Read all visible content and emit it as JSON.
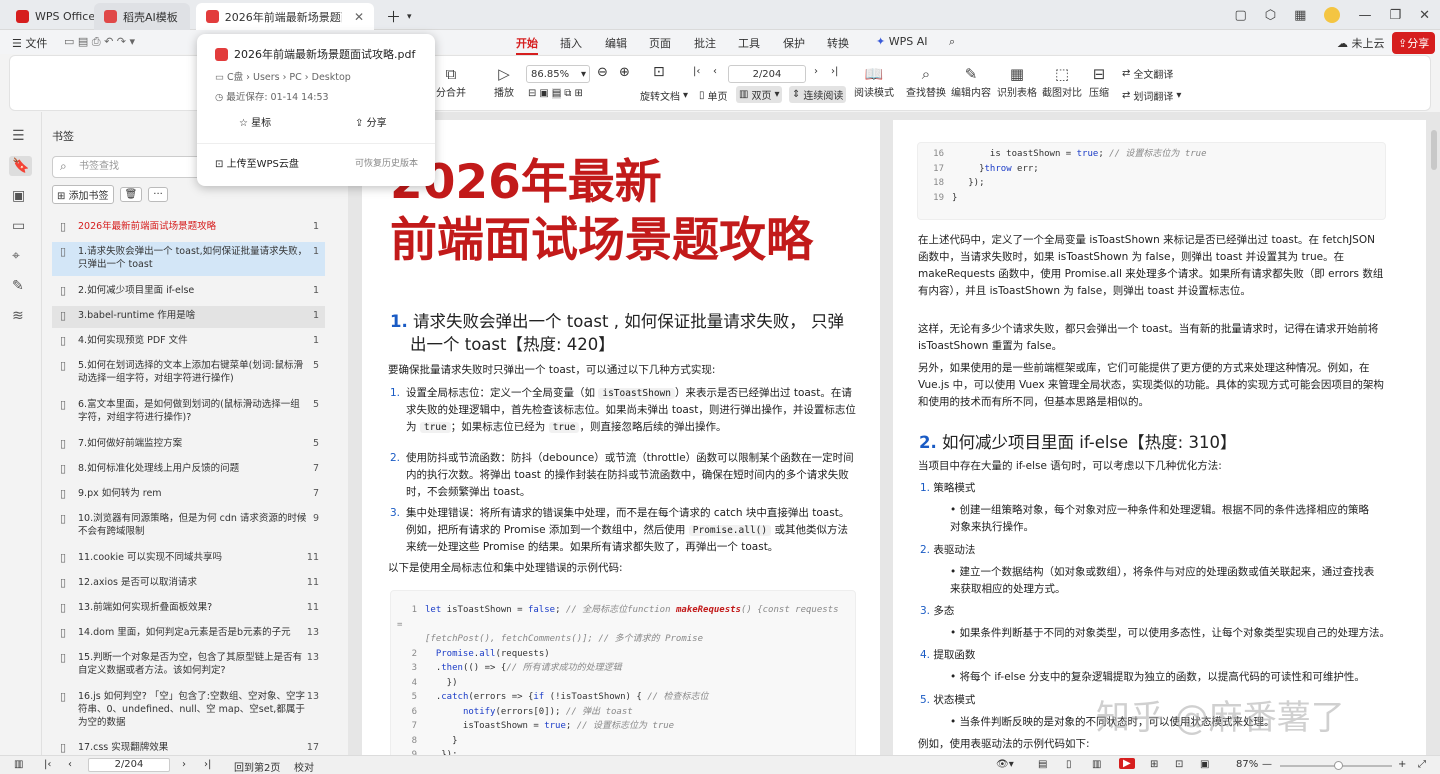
{
  "tabs": [
    {
      "label": "WPS Office"
    },
    {
      "label": "稻壳AI模板"
    },
    {
      "label": "2026年前端最新场景题面试攻"
    }
  ],
  "menu": {
    "file": "文件",
    "items": [
      "开始",
      "插入",
      "编辑",
      "页面",
      "批注",
      "工具",
      "保护",
      "转换"
    ],
    "ai": "WPS AI",
    "cloud": "未上云",
    "share": "分享"
  },
  "popup": {
    "filename": "2026年前端最新场景题面试攻略.pdf",
    "path": "C盘 › Users › PC › Desktop",
    "saved": "最近保存: 01-14 14:53",
    "star": "星标",
    "share": "分享",
    "upload": "上传至WPS云盘",
    "history": "可恢复历史版本"
  },
  "toolbar": {
    "split": "分合并",
    "play": "播放",
    "zoom": "86.85%",
    "page": "2/204",
    "rotate": "旋转文档",
    "single": "单页",
    "double": "双页",
    "continuous": "连续阅读",
    "reading": "阅读模式",
    "find": "查找替换",
    "edit": "编辑内容",
    "table": "识别表格",
    "screenshot": "截图对比",
    "compress": "压缩",
    "translate_all": "全文翻译",
    "translate_sel": "划词翻译"
  },
  "bookmarks": {
    "title": "书签",
    "search_placeholder": "书签查找",
    "add": "添加书签",
    "items": [
      {
        "text": "2026年最新前端面试场景题攻略",
        "page": "1"
      },
      {
        "text": "1.请求失败会弹出一个 toast,如何保证批量请求失败，只弹出一个 toast",
        "page": "1"
      },
      {
        "text": "2.如何减少项目里面 if-else",
        "page": "1"
      },
      {
        "text": "3.babel-runtime 作用是啥",
        "page": "1"
      },
      {
        "text": "4.如何实现预览 PDF 文件",
        "page": "1"
      },
      {
        "text": "5.如何在划词选择的文本上添加右键菜单(划词:鼠标滑动选择一组字符，对组字符进行操作)",
        "page": "5"
      },
      {
        "text": "6.富文本里面，是如何做到划词的(鼠标滑动选择一组字符，对组字符进行操作)?",
        "page": "5"
      },
      {
        "text": "7.如何做好前端监控方案",
        "page": "5"
      },
      {
        "text": "8.如何标准化处理线上用户反馈的问题",
        "page": "7"
      },
      {
        "text": "9.px 如何转为 rem",
        "page": "7"
      },
      {
        "text": "10.浏览器有同源策略，但是为何 cdn 请求资源的时候不会有跨域限制",
        "page": "9"
      },
      {
        "text": "11.cookie 可以实现不同域共享吗",
        "page": "11"
      },
      {
        "text": "12.axios 是否可以取消请求",
        "page": "11"
      },
      {
        "text": " 13.前端如何实现折叠面板效果?",
        "page": "11"
      },
      {
        "text": "14.dom 里面，如何判定a元素是否是b元素的子元",
        "page": "13"
      },
      {
        "text": "15.判断一个对象是否为空，包含了其原型链上是否有自定义数据或者方法。该如何判定?",
        "page": "13"
      },
      {
        "text": "16.js 如何判空? 「空」包含了:空数组、空对象、空字符串、0、undefined、null、空 map、空set,都属于为空的数据",
        "page": "13"
      },
      {
        "text": "17.css 实现翻牌效果",
        "page": "17"
      }
    ]
  },
  "page1": {
    "title_line1": "2026年最新",
    "title_line2": "前端面试场景题攻略",
    "h1_num": "1.",
    "h1_text_a": "请求失败会弹出一个 toast , 如何保证批量请求失败， 只弹",
    "h1_text_b": "出一个 toast【热度: 420】",
    "intro": "要确保批量请求失败时只弹出一个 toast，可以通过以下几种方式实现:",
    "item1_a": "设置全局标志位：定义一个全局变量（如",
    "item1_code": "isToastShown",
    "item1_b": "）来表示是否已经弹出过 toast。在请求失败的处理逻辑中，首先检查该标志位。如果尚未弹出 toast，则进行弹出操作，并设置标志位为",
    "item1_code2": "true",
    "item1_c": "；如果标志位已经为",
    "item1_code3": "true",
    "item1_d": "，则直接忽略后续的弹出操作。",
    "item2": "使用防抖或节流函数：防抖（debounce）或节流（throttle）函数可以限制某个函数在一定时间内的执行次数。将弹出 toast 的操作封装在防抖或节流函数中，确保在短时间内的多个请求失败时，不会频繁弹出 toast。",
    "item3_a": "集中处理错误：将所有请求的错误集中处理，而不是在每个请求的 catch 块中直接弹出 toast。例如，把所有请求的 Promise 添加到一个数组中，然后使用",
    "item3_code": "Promise.all()",
    "item3_b": "或其他类似方法来统一处理这些 Promise 的结果。如果所有请求都失败了，再弹出一个 toast。",
    "code_intro": "以下是使用全局标志位和集中处理错误的示例代码:"
  },
  "page2": {
    "para1": "在上述代码中，定义了一个全局变量 isToastShown 来标记是否已经弹出过 toast。在 fetchJSON 函数中，当请求失败时，如果 isToastShown 为 false，则弹出 toast 并设置其为 true。在 makeRequests 函数中，使用 Promise.all 来处理多个请求。如果所有请求都失败（即 errors 数组有内容），并且 isToastShown 为 false，则弹出 toast 并设置标志位。",
    "para2": "这样，无论有多少个请求失败，都只会弹出一个 toast。当有新的批量请求时，记得在请求开始前将 isToastShown 重置为 false。",
    "para3": "另外，如果使用的是一些前端框架或库，它们可能提供了更方便的方式来处理这种情况。例如，在 Vue.js 中，可以使用 Vuex 来管理全局状态，实现类似的功能。具体的实现方式可能会因项目的架构和使用的技术而有所不同，但基本思路是相似的。",
    "h2_num": "2.",
    "h2_text": "如何减少项目里面 if-else【热度: 310】",
    "h2_intro": "当项目中存在大量的 if-else 语句时，可以考虑以下几种优化方法:",
    "s1": "策略模式",
    "s1d": "创建一组策略对象，每个对象对应一种条件和处理逻辑。根据不同的条件选择相应的策略对象来执行操作。",
    "s2": "表驱动法",
    "s2d": "建立一个数据结构（如对象或数组），将条件与对应的处理函数或值关联起来，通过查找表来获取相应的处理方式。",
    "s3": "多态",
    "s3d": "如果条件判断基于不同的对象类型，可以使用多态性，让每个对象类型实现自己的处理方法。",
    "s4": "提取函数",
    "s4d": "将每个 if-else 分支中的复杂逻辑提取为独立的函数，以提高代码的可读性和可维护性。",
    "s5": "状态模式",
    "s5d": "当条件判断反映的是对象的不同状态时，可以使用状态模式来处理。",
    "tail": "例如，使用表驱动法的示例代码如下:",
    "watermark": "知乎 @麻番薯了"
  },
  "status": {
    "page": "2/204",
    "back": "回到第2页",
    "proof": "校对",
    "zoom": "87%"
  },
  "colors": {
    "accent": "#d61e1e",
    "link": "#1a5bc4",
    "highlight": "#d3e6f7"
  }
}
